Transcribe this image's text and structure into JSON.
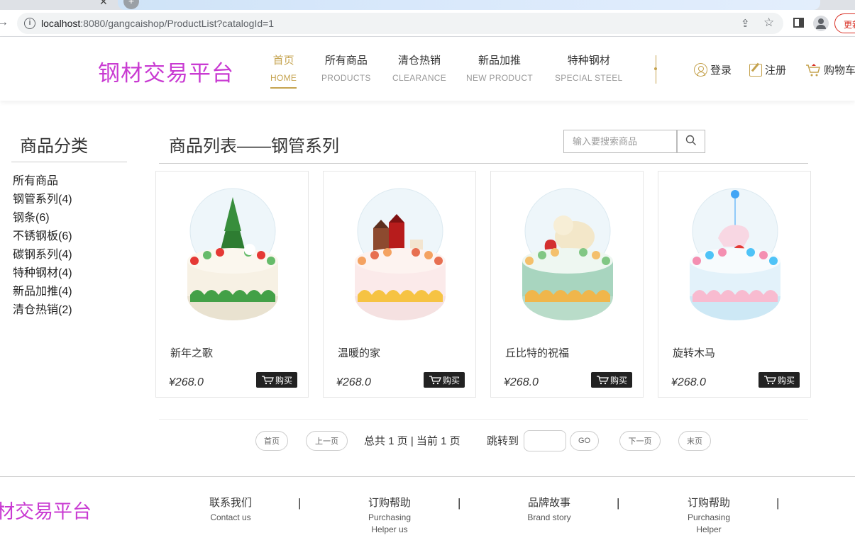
{
  "browser": {
    "url_host": "localhost",
    "url_path": ":8080/gangcaishop/ProductList?catalogId=1",
    "update_label": "更新"
  },
  "header": {
    "logo": "钢材交易平台",
    "nav": [
      {
        "cn": "首页",
        "en": "HOME",
        "active": true
      },
      {
        "cn": "所有商品",
        "en": "PRODUCTS"
      },
      {
        "cn": "清仓热销",
        "en": "CLEARANCE"
      },
      {
        "cn": "新品加推",
        "en": "NEW PRODUCT"
      },
      {
        "cn": "特种钢材",
        "en": "SPECIAL STEEL"
      }
    ],
    "login": "登录",
    "register": "注册",
    "cart": "购物车",
    "accent_color": "#c5a34f",
    "logo_color": "#c93bd2"
  },
  "sidebar": {
    "title": "商品分类",
    "items": [
      "所有商品",
      "钢管系列(4)",
      "钢条(6)",
      "不锈钢板(6)",
      "碳钢系列(4)",
      "特种钢材(4)",
      "新品加推(4)",
      "清仓热销(2)"
    ]
  },
  "main": {
    "title": "商品列表——钢管系列",
    "search_placeholder": "输入要搜索商品",
    "buy_label": "购买",
    "products": [
      {
        "name": "新年之歌",
        "price": "¥268.0"
      },
      {
        "name": "温暖的家",
        "price": "¥268.0"
      },
      {
        "name": "丘比特的祝福",
        "price": "¥268.0"
      },
      {
        "name": "旋转木马",
        "price": "¥268.0"
      }
    ]
  },
  "pagination": {
    "first": "首页",
    "prev": "上一页",
    "summary": "总共 1 页 | 当前 1 页",
    "jump_label": "跳转到",
    "go": "GO",
    "next": "下一页",
    "last": "末页"
  },
  "footer": {
    "logo": "钢材交易平台",
    "items": [
      {
        "cn": "联系我们",
        "en1": "Contact us",
        "en2": ""
      },
      {
        "cn": "订购帮助",
        "en1": "Purchasing",
        "en2": "Helper us"
      },
      {
        "cn": "品牌故事",
        "en1": "Brand story",
        "en2": ""
      },
      {
        "cn": "订购帮助",
        "en1": "Purchasing",
        "en2": "Helper"
      }
    ],
    "separator": "|"
  }
}
